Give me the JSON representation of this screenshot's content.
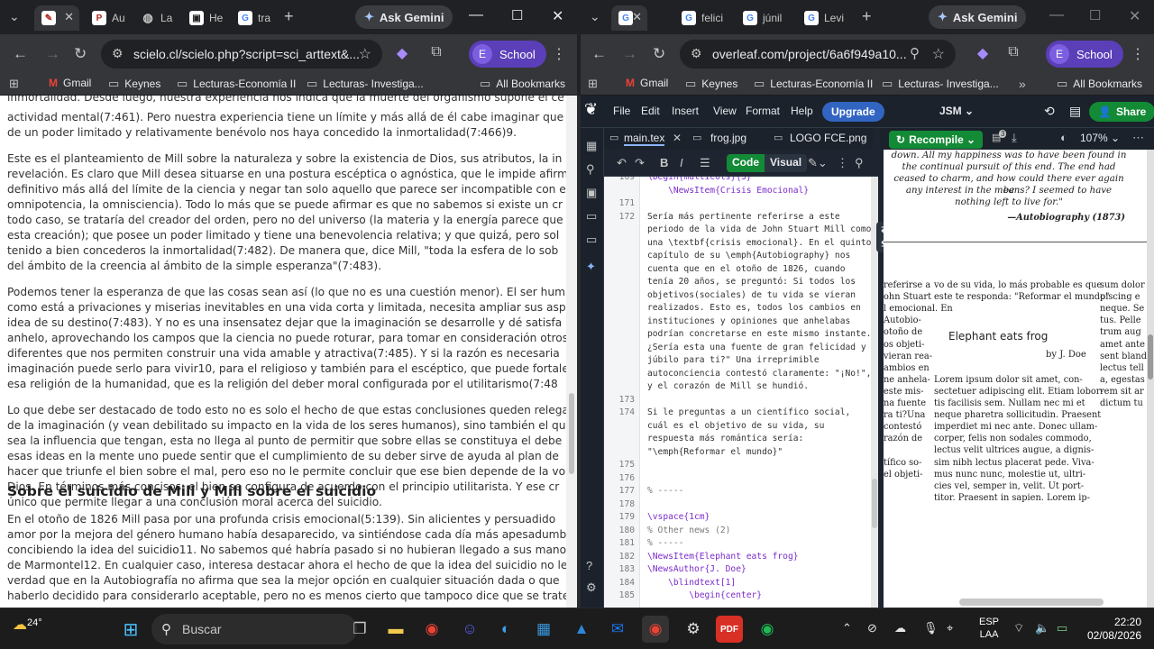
{
  "left_window": {
    "tabs": [
      {
        "label": "",
        "icon": "scielo-icon",
        "active": true
      },
      {
        "label": "Au",
        "icon": "pdf-icon"
      },
      {
        "label": "La",
        "icon": "globe-icon"
      },
      {
        "label": "He",
        "icon": "book-icon"
      },
      {
        "label": "tra",
        "icon": "google-icon"
      }
    ],
    "ask_gemini": "Ask Gemini",
    "url": "scielo.cl/scielo.php?script=sci_arttext&...",
    "profile_initial": "E",
    "profile_label": "School",
    "bookmarks": [
      "Gmail",
      "Keynes",
      "Lecturas-Economía II",
      "Lecturas- Investiga..."
    ],
    "all_bookmarks": "All Bookmarks",
    "article_lines": [
      "inmortalidad. Desde luego, nuestra experiencia nos indica que la muerte del organismo supone el ce",
      "actividad mental(7:461). Pero nuestra experiencia tiene un límite y más allá de él cabe imaginar que",
      "de un poder limitado y relativamente benévolo nos haya concedido la inmortalidad(7:466)9.",
      "Este es el planteamiento de Mill sobre la naturaleza y sobre la existencia de Dios, sus atributos, la in",
      "revelación. Es claro que Mill desea situarse en una postura escéptica o agnóstica, que le impide afirm",
      "definitivo más allá del límite de la ciencia y negar tan solo aquello que parece ser incompatible con e",
      "omnipotencia, la omnisciencia). Todo lo más que se puede afirmar es que no sabemos si existe un cr",
      "todo caso, se trataría del creador del orden, pero no del universo (la materia y la energía parece que",
      "esta creación); que posee un poder limitado y tiene una benevolencia relativa; y que quizá, pero sol",
      "tenido a bien concederos la inmortalidad(7:482). De manera que, dice Mill, \"toda la esfera de lo sob",
      "del ámbito de la creencia al ámbito de la simple esperanza\"(7:483).",
      "Podemos tener la esperanza de que las cosas sean así (lo que no es una cuestión menor). El ser hum",
      "como está a privaciones y miserias inevitables en una vida corta y limitada, necesita ampliar sus asp",
      "idea de su destino(7:483). Y no es una insensatez dejar que la imaginación se desarrolle y dé satisfa",
      "anhelo, aprovechando los campos que la ciencia no puede roturar, para tomar en consideración otros",
      "diferentes que nos permiten construir una vida amable y atractiva(7:485). Y si la razón es necesaria",
      "imaginación puede serlo para vivir10, para el religioso y también para el escéptico, que puede fortale",
      "esa religión de la humanidad, que es la religión del deber moral configurada por el utilitarismo(7:48",
      "Lo que debe ser destacado de todo esto no es solo el hecho de que estas conclusiones queden relega",
      "de la imaginación (y vean debilitado su impacto en la vida de los seres humanos), sino también el qu",
      "sea la influencia que tengan, esta no llega al punto de permitir que sobre ellas se constituya el debe",
      "esas ideas en la mente uno puede sentir que el cumplimiento de su deber sirve de ayuda al plan de",
      "hacer que triunfe el bien sobre el mal, pero eso no le permite concluir que ese bien depende de la vo",
      "Dios. En términos más concisos: el bien se configura de acuerdo con el principio utilitarista. Y ese cr",
      "único que permite llegar a una conclusión moral acerca del suicidio.",
      "Sobre el suicidio de Mill y Mill sobre el suicidio",
      "En el otoño de 1826 Mill pasa por una profunda crisis emocional(5:139). Sin alicientes y persuadido",
      "amor por la mejora del género humano había desaparecido, va sintiéndose cada día más apesadumb",
      "concibiendo la idea del suicidio11. No sabemos qué habría pasado si no hubieran llegado a sus mano",
      "de Marmontel12. En cualquier caso, interesa destacar ahora el hecho de que la idea del suicidio no le",
      "verdad que en la Autobiografía no afirma que sea la mejor opción en cualquier situación dada o que",
      "haberlo decidido para considerarlo aceptable, pero no es menos cierto que tampoco dice que se trate"
    ]
  },
  "right_window": {
    "tabs": [
      {
        "label": "",
        "icon": "google-icon",
        "active": true
      },
      {
        "label": "felici",
        "icon": "google-icon"
      },
      {
        "label": "júnil",
        "icon": "google-icon"
      },
      {
        "label": "Levi",
        "icon": "google-icon"
      }
    ],
    "ask_gemini": "Ask Gemini",
    "url": "overleaf.com/project/6a6f949a10...",
    "profile_initial": "E",
    "profile_label": "School",
    "bookmarks": [
      "Gmail",
      "Keynes",
      "Lecturas-Economía II",
      "Lecturas- Investiga..."
    ],
    "all_bookmarks": "All Bookmarks",
    "overleaf": {
      "menu": [
        "File",
        "Edit",
        "Insert",
        "View",
        "Format",
        "Help"
      ],
      "upgrade": "Upgrade",
      "project": "JSM",
      "share": "Share",
      "files": [
        "main.tex",
        "frog.jpg",
        "LOGO FCE.png"
      ],
      "code_label": "Code",
      "visual_label": "Visual",
      "recompile": "Recompile",
      "zoom": "107%",
      "log_count": "3",
      "editor_lines": [
        {
          "n": "169",
          "t": "\\begin{multicols}{3}"
        },
        {
          "n": "",
          "t": "    \\NewsItem{Crisis Emocional}"
        },
        {
          "n": "171",
          "t": ""
        },
        {
          "n": "172",
          "t": "Sería más pertinente referirse a este"
        },
        {
          "n": "",
          "t": "periodo de la vida de John Stuart Mill como"
        },
        {
          "n": "",
          "t": "una \\textbf{crisis emocional}. En el quinto"
        },
        {
          "n": "",
          "t": "capítulo de su \\emph{Autobiography} nos"
        },
        {
          "n": "",
          "t": "cuenta que en el otoño de 1826, cuando"
        },
        {
          "n": "",
          "t": "tenía 20 años, se preguntó: Si todos los"
        },
        {
          "n": "",
          "t": "objetivos(sociales) de tu vida se vieran"
        },
        {
          "n": "",
          "t": "realizados. Esto es, todos los cambios en"
        },
        {
          "n": "",
          "t": "instituciones y opiniones que anhelabas"
        },
        {
          "n": "",
          "t": "podrían concretarse en este mismo instante."
        },
        {
          "n": "",
          "t": "¿Sería esta una fuente de gran felicidad y"
        },
        {
          "n": "",
          "t": "júbilo para ti?\" Una irreprimible"
        },
        {
          "n": "",
          "t": "autoconciencia contestó claramente: \"¡No!\","
        },
        {
          "n": "",
          "t": "y el corazón de Mill se hundió."
        },
        {
          "n": "173",
          "t": ""
        },
        {
          "n": "174",
          "t": "Si le preguntas a un científico social,"
        },
        {
          "n": "",
          "t": "cuál es el objetivo de su vida, su"
        },
        {
          "n": "",
          "t": "respuesta más romántica sería:"
        },
        {
          "n": "",
          "t": "\"\\emph{Reformar el mundo}\""
        },
        {
          "n": "175",
          "t": ""
        },
        {
          "n": "176",
          "t": ""
        },
        {
          "n": "177",
          "t": "% -----"
        },
        {
          "n": "178",
          "t": ""
        },
        {
          "n": "179",
          "t": "\\vspace{1cm}"
        },
        {
          "n": "180",
          "t": "% Other news (2)"
        },
        {
          "n": "181",
          "t": "% -----"
        },
        {
          "n": "182",
          "t": "\\NewsItem{Elephant eats frog}"
        },
        {
          "n": "183",
          "t": "\\NewsAuthor{J. Doe}"
        },
        {
          "n": "184",
          "t": "    \\blindtext[1]"
        },
        {
          "n": "185",
          "t": "        \\begin{center}"
        }
      ],
      "pdf": {
        "quote_lines": [
          "down. All my happiness was to have been found in",
          "the continual pursuit of this end. The end had",
          "ceased to charm, and how could there ever again be",
          "any interest in the means? I seemed to have",
          "nothing left to live for.\""
        ],
        "quote_attribution": "—Autobiography (1873)",
        "left_col": [
          "referirse a",
          "ohn Stuart",
          "l emocional. En",
          "Autobio-",
          "otoño de",
          "os objeti-",
          "vieran rea-",
          "ambios en",
          "ne anhela-",
          "este mis-",
          "na fuente",
          "ra ti?Una",
          "contestó",
          "razón de",
          "",
          "tífico so-",
          "el objeti-"
        ],
        "mid_col": [
          "vo de su vida, lo más probable es que",
          "este te responda: \"Reformar el mundo\"",
          "",
          "",
          "",
          "",
          "",
          "",
          "Lorem ipsum dolor sit amet, con-",
          "sectetuer adipiscing elit. Etiam lobor-",
          "tis facilisis sem. Nullam nec mi et",
          "neque pharetra sollicitudin. Praesent",
          "imperdiet mi nec ante. Donec ullam-",
          "corper, felis non sodales commodo,",
          "lectus velit ultrices augue, a dignis-",
          "sim nibh lectus placerat pede. Viva-",
          "mus nunc nunc, molestie ut, ultri-",
          "cies vel, semper in, velit. Ut port-",
          "titor. Praesent in sapien. Lorem ip-"
        ],
        "news_title": "Elephant eats frog",
        "news_author": "by J. Doe",
        "right_col": [
          "sum dolor",
          "piscing e",
          "neque. Se",
          "tus. Pelle",
          "trum aug",
          "amet ante",
          "sent bland",
          "lectus tell",
          "a, egestas",
          "rem sit ar",
          "dictum tu"
        ]
      }
    }
  },
  "taskbar": {
    "weather": "24°",
    "search_placeholder": "Buscar",
    "language": "ESP",
    "language_sub": "LAA",
    "time": "22:20",
    "date": "02/08/2026"
  }
}
